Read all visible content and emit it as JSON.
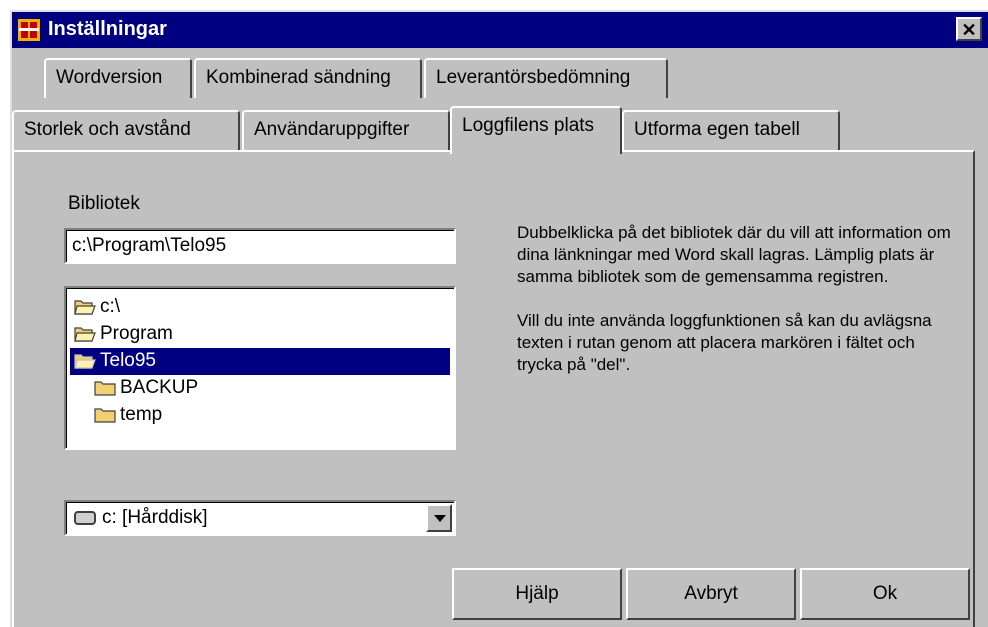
{
  "window": {
    "title": "Inställningar",
    "close_label": "✕"
  },
  "tabs_row1": [
    {
      "label": "Wordversion"
    },
    {
      "label": "Kombinerad sändning"
    },
    {
      "label": "Leverantörsbedömning"
    }
  ],
  "tabs_row2": [
    {
      "label": "Storlek och avstånd"
    },
    {
      "label": "Användaruppgifter"
    },
    {
      "label": "Loggfilens plats",
      "selected": true
    },
    {
      "label": "Utforma egen tabell"
    }
  ],
  "panel": {
    "directory_label": "Bibliotek",
    "path_value": "c:\\Program\\Telo95",
    "directories": [
      {
        "name": "c:\\"
      },
      {
        "name": "Program"
      },
      {
        "name": "Telo95",
        "selected": true
      },
      {
        "name": "BACKUP"
      },
      {
        "name": "temp"
      }
    ],
    "drive_value": "c: [Hårddisk]",
    "info_text_1": "Dubbelklicka på det bibliotek där du vill att information om dina länkningar med Word skall lagras. Lämplig plats är samma bibliotek som de gemensamma registren.",
    "info_text_2": "Vill du inte använda loggfunktionen så kan du avlägsna texten i rutan genom att placera markören i fältet och trycka på \"del\"."
  },
  "buttons": {
    "help": "Hjälp",
    "cancel": "Avbryt",
    "ok": "Ok"
  },
  "colors": {
    "titlebar": "#000080",
    "face": "#c0c0c0",
    "selection": "#000080",
    "folder": "#f0d070"
  }
}
